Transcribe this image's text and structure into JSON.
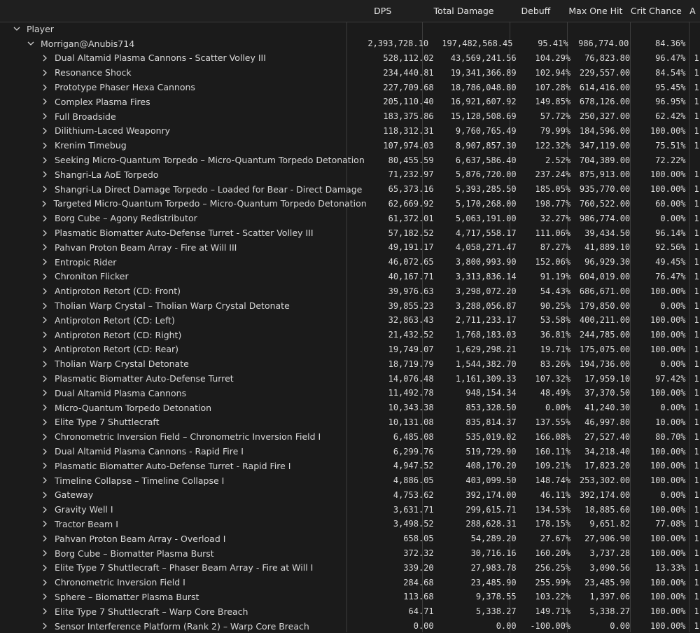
{
  "columns": [
    "DPS",
    "Total Damage",
    "Debuff",
    "Max One Hit",
    "Crit Chance",
    "A"
  ],
  "group": {
    "label": "Player"
  },
  "player": {
    "name": "Morrigan@Anubis714",
    "dps": "2,393,728.10",
    "total": "197,482,568.45",
    "debuff": "95.41%",
    "max": "986,774.00",
    "crit": "84.36%"
  },
  "abilities": [
    {
      "name": "Dual Altamid Plasma Cannons - Scatter Volley III",
      "dps": "528,112.02",
      "total": "43,569,241.56",
      "debuff": "104.29%",
      "max": "76,823.80",
      "crit": "96.47%",
      "extra": "1"
    },
    {
      "name": "Resonance Shock",
      "dps": "234,440.81",
      "total": "19,341,366.89",
      "debuff": "102.94%",
      "max": "229,557.00",
      "crit": "84.54%",
      "extra": "1"
    },
    {
      "name": "Prototype Phaser Hexa Cannons",
      "dps": "227,709.68",
      "total": "18,786,048.80",
      "debuff": "107.28%",
      "max": "614,416.00",
      "crit": "95.45%",
      "extra": "1"
    },
    {
      "name": "Complex Plasma Fires",
      "dps": "205,110.40",
      "total": "16,921,607.92",
      "debuff": "149.85%",
      "max": "678,126.00",
      "crit": "96.95%",
      "extra": "1"
    },
    {
      "name": "Full Broadside",
      "dps": "183,375.86",
      "total": "15,128,508.69",
      "debuff": "57.72%",
      "max": "250,327.00",
      "crit": "62.42%",
      "extra": "1"
    },
    {
      "name": "Dilithium-Laced Weaponry",
      "dps": "118,312.31",
      "total": "9,760,765.49",
      "debuff": "79.99%",
      "max": "184,596.00",
      "crit": "100.00%",
      "extra": "1"
    },
    {
      "name": "Krenim Timebug",
      "dps": "107,974.03",
      "total": "8,907,857.30",
      "debuff": "122.32%",
      "max": "347,119.00",
      "crit": "75.51%",
      "extra": "1"
    },
    {
      "name": "Seeking Micro-Quantum Torpedo – Micro-Quantum Torpedo Detonation",
      "dps": "80,455.59",
      "total": "6,637,586.40",
      "debuff": "2.52%",
      "max": "704,389.00",
      "crit": "72.22%",
      "extra": ""
    },
    {
      "name": "Shangri-La AoE Torpedo",
      "dps": "71,232.97",
      "total": "5,876,720.00",
      "debuff": "237.24%",
      "max": "875,913.00",
      "crit": "100.00%",
      "extra": "1"
    },
    {
      "name": "Shangri-La Direct Damage Torpedo – Loaded for Bear - Direct Damage",
      "dps": "65,373.16",
      "total": "5,393,285.50",
      "debuff": "185.05%",
      "max": "935,770.00",
      "crit": "100.00%",
      "extra": "1"
    },
    {
      "name": "Targeted Micro-Quantum Torpedo – Micro-Quantum Torpedo Detonation",
      "dps": "62,669.92",
      "total": "5,170,268.00",
      "debuff": "198.77%",
      "max": "760,522.00",
      "crit": "60.00%",
      "extra": "1"
    },
    {
      "name": "Borg Cube – Agony Redistributor",
      "dps": "61,372.01",
      "total": "5,063,191.00",
      "debuff": "32.27%",
      "max": "986,774.00",
      "crit": "0.00%",
      "extra": "1"
    },
    {
      "name": "Plasmatic Biomatter Auto-Defense Turret - Scatter Volley III",
      "dps": "57,182.52",
      "total": "4,717,558.17",
      "debuff": "111.06%",
      "max": "39,434.50",
      "crit": "96.14%",
      "extra": "1"
    },
    {
      "name": "Pahvan Proton Beam Array - Fire at Will III",
      "dps": "49,191.17",
      "total": "4,058,271.47",
      "debuff": "87.27%",
      "max": "41,889.10",
      "crit": "92.56%",
      "extra": "1"
    },
    {
      "name": "Entropic Rider",
      "dps": "46,072.65",
      "total": "3,800,993.90",
      "debuff": "152.06%",
      "max": "96,929.30",
      "crit": "49.45%",
      "extra": "1"
    },
    {
      "name": "Chroniton Flicker",
      "dps": "40,167.71",
      "total": "3,313,836.14",
      "debuff": "91.19%",
      "max": "604,019.00",
      "crit": "76.47%",
      "extra": "1"
    },
    {
      "name": "Antiproton Retort (CD: Front)",
      "dps": "39,976.63",
      "total": "3,298,072.20",
      "debuff": "54.43%",
      "max": "686,671.00",
      "crit": "100.00%",
      "extra": "1"
    },
    {
      "name": "Tholian Warp Crystal – Tholian Warp Crystal Detonate",
      "dps": "39,855.23",
      "total": "3,288,056.87",
      "debuff": "90.25%",
      "max": "179,850.00",
      "crit": "0.00%",
      "extra": "1"
    },
    {
      "name": "Antiproton Retort (CD: Left)",
      "dps": "32,863.43",
      "total": "2,711,233.17",
      "debuff": "53.58%",
      "max": "400,211.00",
      "crit": "100.00%",
      "extra": "1"
    },
    {
      "name": "Antiproton Retort (CD: Right)",
      "dps": "21,432.52",
      "total": "1,768,183.03",
      "debuff": "36.81%",
      "max": "244,785.00",
      "crit": "100.00%",
      "extra": "1"
    },
    {
      "name": "Antiproton Retort (CD: Rear)",
      "dps": "19,749.07",
      "total": "1,629,298.21",
      "debuff": "19.71%",
      "max": "175,075.00",
      "crit": "100.00%",
      "extra": "1"
    },
    {
      "name": "Tholian Warp Crystal Detonate",
      "dps": "18,719.79",
      "total": "1,544,382.70",
      "debuff": "83.26%",
      "max": "194,736.00",
      "crit": "0.00%",
      "extra": "1"
    },
    {
      "name": "Plasmatic Biomatter Auto-Defense Turret",
      "dps": "14,076.48",
      "total": "1,161,309.33",
      "debuff": "107.32%",
      "max": "17,959.10",
      "crit": "97.42%",
      "extra": "1"
    },
    {
      "name": "Dual Altamid Plasma Cannons",
      "dps": "11,492.78",
      "total": "948,154.34",
      "debuff": "48.49%",
      "max": "37,370.50",
      "crit": "100.00%",
      "extra": "1"
    },
    {
      "name": "Micro-Quantum Torpedo Detonation",
      "dps": "10,343.38",
      "total": "853,328.50",
      "debuff": "0.00%",
      "max": "41,240.30",
      "crit": "0.00%",
      "extra": "1"
    },
    {
      "name": "Elite Type 7 Shuttlecraft",
      "dps": "10,131.08",
      "total": "835,814.37",
      "debuff": "137.55%",
      "max": "46,997.80",
      "crit": "10.00%",
      "extra": "1"
    },
    {
      "name": "Chronometric Inversion Field – Chronometric Inversion Field I",
      "dps": "6,485.08",
      "total": "535,019.02",
      "debuff": "166.08%",
      "max": "27,527.40",
      "crit": "80.70%",
      "extra": "1"
    },
    {
      "name": "Dual Altamid Plasma Cannons - Rapid Fire I",
      "dps": "6,299.76",
      "total": "519,729.90",
      "debuff": "160.11%",
      "max": "34,218.40",
      "crit": "100.00%",
      "extra": "1"
    },
    {
      "name": "Plasmatic Biomatter Auto-Defense Turret - Rapid Fire I",
      "dps": "4,947.52",
      "total": "408,170.20",
      "debuff": "109.21%",
      "max": "17,823.20",
      "crit": "100.00%",
      "extra": "1"
    },
    {
      "name": "Timeline Collapse – Timeline Collapse I",
      "dps": "4,886.05",
      "total": "403,099.50",
      "debuff": "148.74%",
      "max": "253,302.00",
      "crit": "100.00%",
      "extra": "1"
    },
    {
      "name": "Gateway",
      "dps": "4,753.62",
      "total": "392,174.00",
      "debuff": "46.11%",
      "max": "392,174.00",
      "crit": "0.00%",
      "extra": "1"
    },
    {
      "name": "Gravity Well I",
      "dps": "3,631.71",
      "total": "299,615.71",
      "debuff": "134.53%",
      "max": "18,885.60",
      "crit": "100.00%",
      "extra": "1"
    },
    {
      "name": "Tractor Beam I",
      "dps": "3,498.52",
      "total": "288,628.31",
      "debuff": "178.15%",
      "max": "9,651.82",
      "crit": "77.08%",
      "extra": "1"
    },
    {
      "name": "Pahvan Proton Beam Array - Overload I",
      "dps": "658.05",
      "total": "54,289.20",
      "debuff": "27.67%",
      "max": "27,906.90",
      "crit": "100.00%",
      "extra": "1"
    },
    {
      "name": "Borg Cube – Biomatter Plasma Burst",
      "dps": "372.32",
      "total": "30,716.16",
      "debuff": "160.20%",
      "max": "3,737.28",
      "crit": "100.00%",
      "extra": "1"
    },
    {
      "name": "Elite Type 7 Shuttlecraft – Phaser Beam Array - Fire at Will I",
      "dps": "339.20",
      "total": "27,983.78",
      "debuff": "256.25%",
      "max": "3,090.56",
      "crit": "13.33%",
      "extra": "1"
    },
    {
      "name": "Chronometric Inversion Field I",
      "dps": "284.68",
      "total": "23,485.90",
      "debuff": "255.99%",
      "max": "23,485.90",
      "crit": "100.00%",
      "extra": "1"
    },
    {
      "name": "Sphere – Biomatter Plasma Burst",
      "dps": "113.68",
      "total": "9,378.55",
      "debuff": "103.22%",
      "max": "1,397.06",
      "crit": "100.00%",
      "extra": "1"
    },
    {
      "name": "Elite Type 7 Shuttlecraft – Warp Core Breach",
      "dps": "64.71",
      "total": "5,338.27",
      "debuff": "149.71%",
      "max": "5,338.27",
      "crit": "100.00%",
      "extra": "1"
    },
    {
      "name": "Sensor Interference Platform (Rank 2) – Warp Core Breach",
      "dps": "0.00",
      "total": "0.00",
      "debuff": "-100.00%",
      "max": "0.00",
      "crit": "100.00%",
      "extra": "1"
    }
  ]
}
